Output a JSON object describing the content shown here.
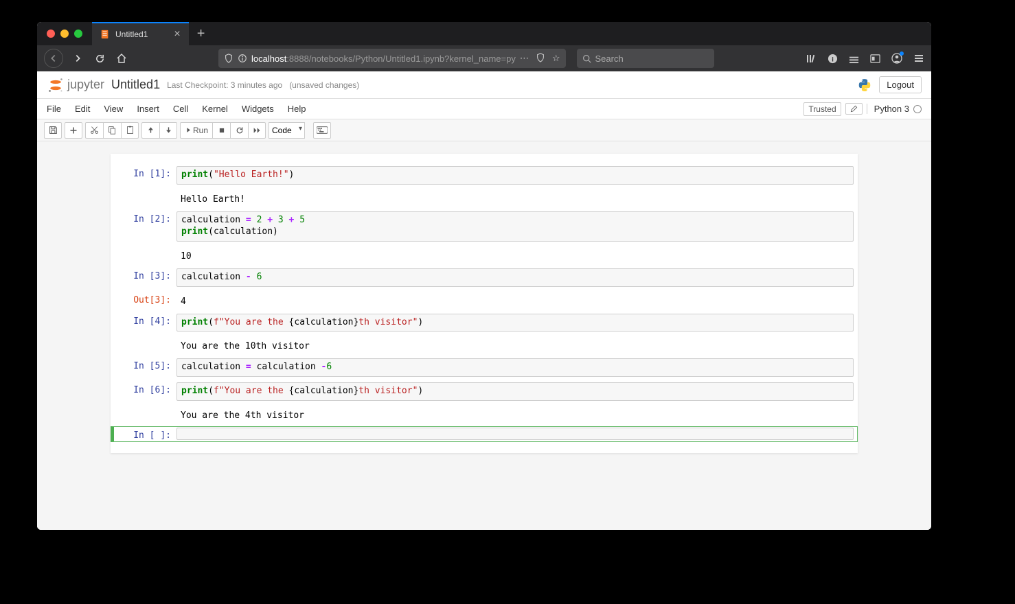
{
  "browser": {
    "tab_title": "Untitled1",
    "url_host": "localhost",
    "url_path": ":8888/notebooks/Python/Untitled1.ipynb?kernel_name=py",
    "search_placeholder": "Search"
  },
  "header": {
    "logo_text": "jupyter",
    "notebook_name": "Untitled1",
    "checkpoint": "Last Checkpoint: 3 minutes ago",
    "unsaved": "(unsaved changes)",
    "logout": "Logout"
  },
  "menubar": {
    "items": [
      "File",
      "Edit",
      "View",
      "Insert",
      "Cell",
      "Kernel",
      "Widgets",
      "Help"
    ],
    "trusted": "Trusted",
    "kernel": "Python 3"
  },
  "toolbar": {
    "run_label": "Run",
    "celltype": "Code"
  },
  "cells": [
    {
      "in_prompt": "In [1]:",
      "code_html": "<span class='cm-builtin'>print</span>(<span class='cm-string'>\"Hello Earth!\"</span>)",
      "output": "Hello Earth!"
    },
    {
      "in_prompt": "In [2]:",
      "code_html": "calculation <span class='cm-op'>=</span> <span class='cm-num'>2</span> <span class='cm-op'>+</span> <span class='cm-num'>3</span> <span class='cm-op'>+</span> <span class='cm-num'>5</span>\n<span class='cm-builtin'>print</span>(calculation)",
      "output": "10"
    },
    {
      "in_prompt": "In [3]:",
      "code_html": "calculation <span class='cm-op'>-</span> <span class='cm-num'>6</span>",
      "out_prompt": "Out[3]:",
      "result": "4"
    },
    {
      "in_prompt": "In [4]:",
      "code_html": "<span class='cm-builtin'>print</span>(<span class='cm-string'>f\"You are the </span>{calculation}<span class='cm-string'>th visitor\"</span>)",
      "output": "You are the 10th visitor"
    },
    {
      "in_prompt": "In [5]:",
      "code_html": "calculation <span class='cm-op'>=</span> calculation <span class='cm-op'>-</span><span class='cm-num'>6</span>"
    },
    {
      "in_prompt": "In [6]:",
      "code_html": "<span class='cm-builtin'>print</span>(<span class='cm-string'>f\"You are the </span>{calculation}<span class='cm-string'>th visitor\"</span>)",
      "output": "You are the 4th visitor"
    },
    {
      "in_prompt": "In [ ]:",
      "code_html": "",
      "selected": true
    }
  ]
}
